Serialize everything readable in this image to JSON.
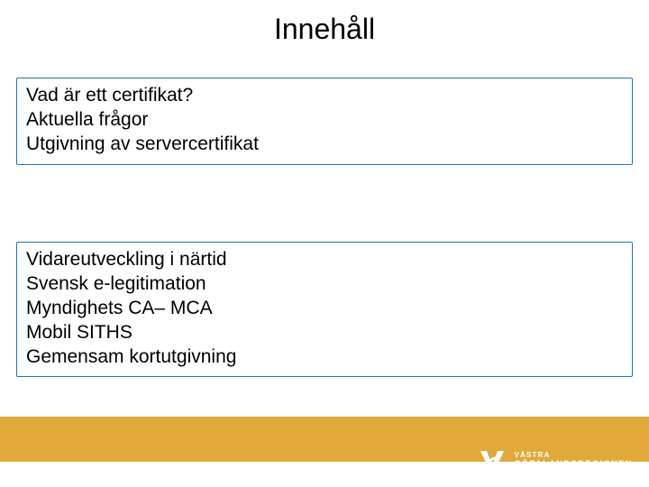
{
  "title": "Innehåll",
  "box1": {
    "lines": [
      "Vad är ett certifikat?",
      "Aktuella frågor",
      "Utgivning av servercertifikat"
    ]
  },
  "box2": {
    "lines": [
      "Vidareutveckling i närtid",
      "Svensk e-legitimation",
      "Myndighets CA– MCA",
      "Mobil SITHS",
      "Gemensam kortutgivning"
    ]
  },
  "footer": {
    "logo_line1": "VÄSTRA",
    "logo_line2": "GÖTALANDSREGIONEN"
  },
  "colors": {
    "accent": "#e0a93a",
    "box_border": "#1976b8"
  }
}
